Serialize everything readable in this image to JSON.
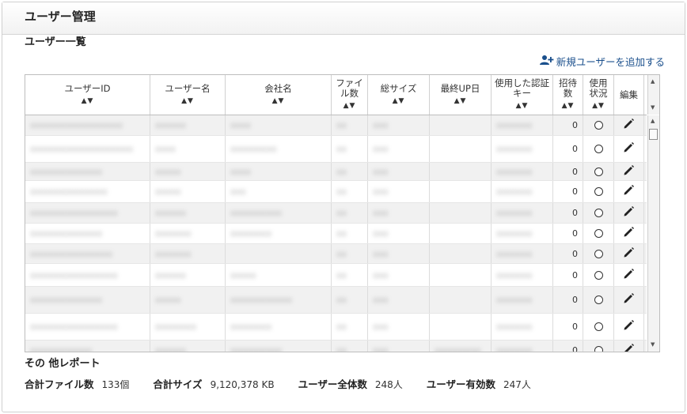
{
  "panel": {
    "title": "ユーザー管理"
  },
  "list": {
    "title": "ユーザー一覧",
    "add_link": "新規ユーザーを追加する",
    "columns": [
      {
        "key": "user_id",
        "label": "ユーザーID",
        "sortable": true
      },
      {
        "key": "user_name",
        "label": "ユーザー名",
        "sortable": true
      },
      {
        "key": "company",
        "label": "会社名",
        "sortable": true
      },
      {
        "key": "file_count",
        "label": "ファイル数",
        "sortable": true
      },
      {
        "key": "total_size",
        "label": "総サイズ",
        "sortable": true
      },
      {
        "key": "last_up",
        "label": "最終UP日",
        "sortable": true
      },
      {
        "key": "auth_key",
        "label": "使用した認証キー",
        "sortable": true
      },
      {
        "key": "invites",
        "label": "招待数",
        "sortable": true
      },
      {
        "key": "usage",
        "label": "使用状況",
        "sortable": true
      },
      {
        "key": "edit",
        "label": "編集",
        "sortable": false
      }
    ],
    "sort_glyph": "▲▼",
    "rows": [
      {
        "user_id": "xxxxxxxxxxxxxxxxxx",
        "user_name": "xxxxxx",
        "company": "xxxx",
        "file_count": "xx",
        "total_size": "xxx",
        "last_up": "",
        "auth_key": "xxxxxxx",
        "invites": "0",
        "usage": "○"
      },
      {
        "user_id": "xxxxxxxxxxxxxxxxxxxx",
        "user_name": "xxxx",
        "company": "xxxxxxxxx",
        "file_count": "xx",
        "total_size": "xxx",
        "last_up": "",
        "auth_key": "xxxxxxx",
        "invites": "0",
        "usage": "○"
      },
      {
        "user_id": "xxxxxxxxxxxxxx",
        "user_name": "xxxxx",
        "company": "xxxx",
        "file_count": "xx",
        "total_size": "xxx",
        "last_up": "",
        "auth_key": "xxxxxxx",
        "invites": "0",
        "usage": "○"
      },
      {
        "user_id": "xxxxxxxxxxxxxxx",
        "user_name": "xxxxx",
        "company": "xxx",
        "file_count": "xx",
        "total_size": "xxx",
        "last_up": "",
        "auth_key": "xxxxxxx",
        "invites": "0",
        "usage": "○"
      },
      {
        "user_id": "xxxxxxxxxxxxxxxxx",
        "user_name": "xxxxxx",
        "company": "xxxxxxxxxx",
        "file_count": "xx",
        "total_size": "xxx",
        "last_up": "",
        "auth_key": "xxxxxxx",
        "invites": "0",
        "usage": "○"
      },
      {
        "user_id": "xxxxxxxxxxxxxx",
        "user_name": "xxxxxxx",
        "company": "xxxxxxxx",
        "file_count": "xx",
        "total_size": "xxx",
        "last_up": "",
        "auth_key": "xxxxxxx",
        "invites": "0",
        "usage": "○"
      },
      {
        "user_id": "xxxxxxxxxxxxxxxx",
        "user_name": "xxxxxxx",
        "company": "",
        "file_count": "xx",
        "total_size": "xxx",
        "last_up": "",
        "auth_key": "xxxxxxx",
        "invites": "0",
        "usage": "○"
      },
      {
        "user_id": "xxxxxxxxxxxxxxxxx",
        "user_name": "xxxxxx",
        "company": "xxxxx",
        "file_count": "xx",
        "total_size": "xxx",
        "last_up": "",
        "auth_key": "xxxxxxx",
        "invites": "0",
        "usage": "○"
      },
      {
        "user_id": "xxxxxxxxxxxxxx",
        "user_name": "xxxxx",
        "company": "xxxxxxxxxxxx",
        "file_count": "xx",
        "total_size": "xxx",
        "last_up": "",
        "auth_key": "xxxxxxx",
        "invites": "0",
        "usage": "○"
      },
      {
        "user_id": "xxxxxxxxxxxxxxxxx",
        "user_name": "xxxxxxxx",
        "company": "xxxxxxxx",
        "file_count": "xx",
        "total_size": "xxx",
        "last_up": "",
        "auth_key": "xxxxxxx",
        "invites": "0",
        "usage": "○"
      },
      {
        "user_id": "xxxxxxxxxxxx",
        "user_name": "xxxxxx",
        "company": "xxxxxxxxxx",
        "file_count": "xx",
        "total_size": "xxx",
        "last_up": "xxxxxxxxx",
        "auth_key": "xxxxxxx",
        "invites": "0",
        "usage": "○"
      }
    ]
  },
  "report": {
    "title": "その 他レポート",
    "stats": [
      {
        "label": "合計ファイル数",
        "value": "133個"
      },
      {
        "label": "合計サイズ",
        "value": "9,120,378 KB"
      },
      {
        "label": "ユーザー全体数",
        "value": "248人"
      },
      {
        "label": "ユーザー有効数",
        "value": "247人"
      }
    ]
  },
  "icons": {
    "add_user": "add-user-icon",
    "edit": "pencil-icon",
    "usage": "circle-icon"
  },
  "colors": {
    "link": "#1a4f8c",
    "row_alt": "#f1f1f1",
    "border": "#bdbdbd"
  }
}
